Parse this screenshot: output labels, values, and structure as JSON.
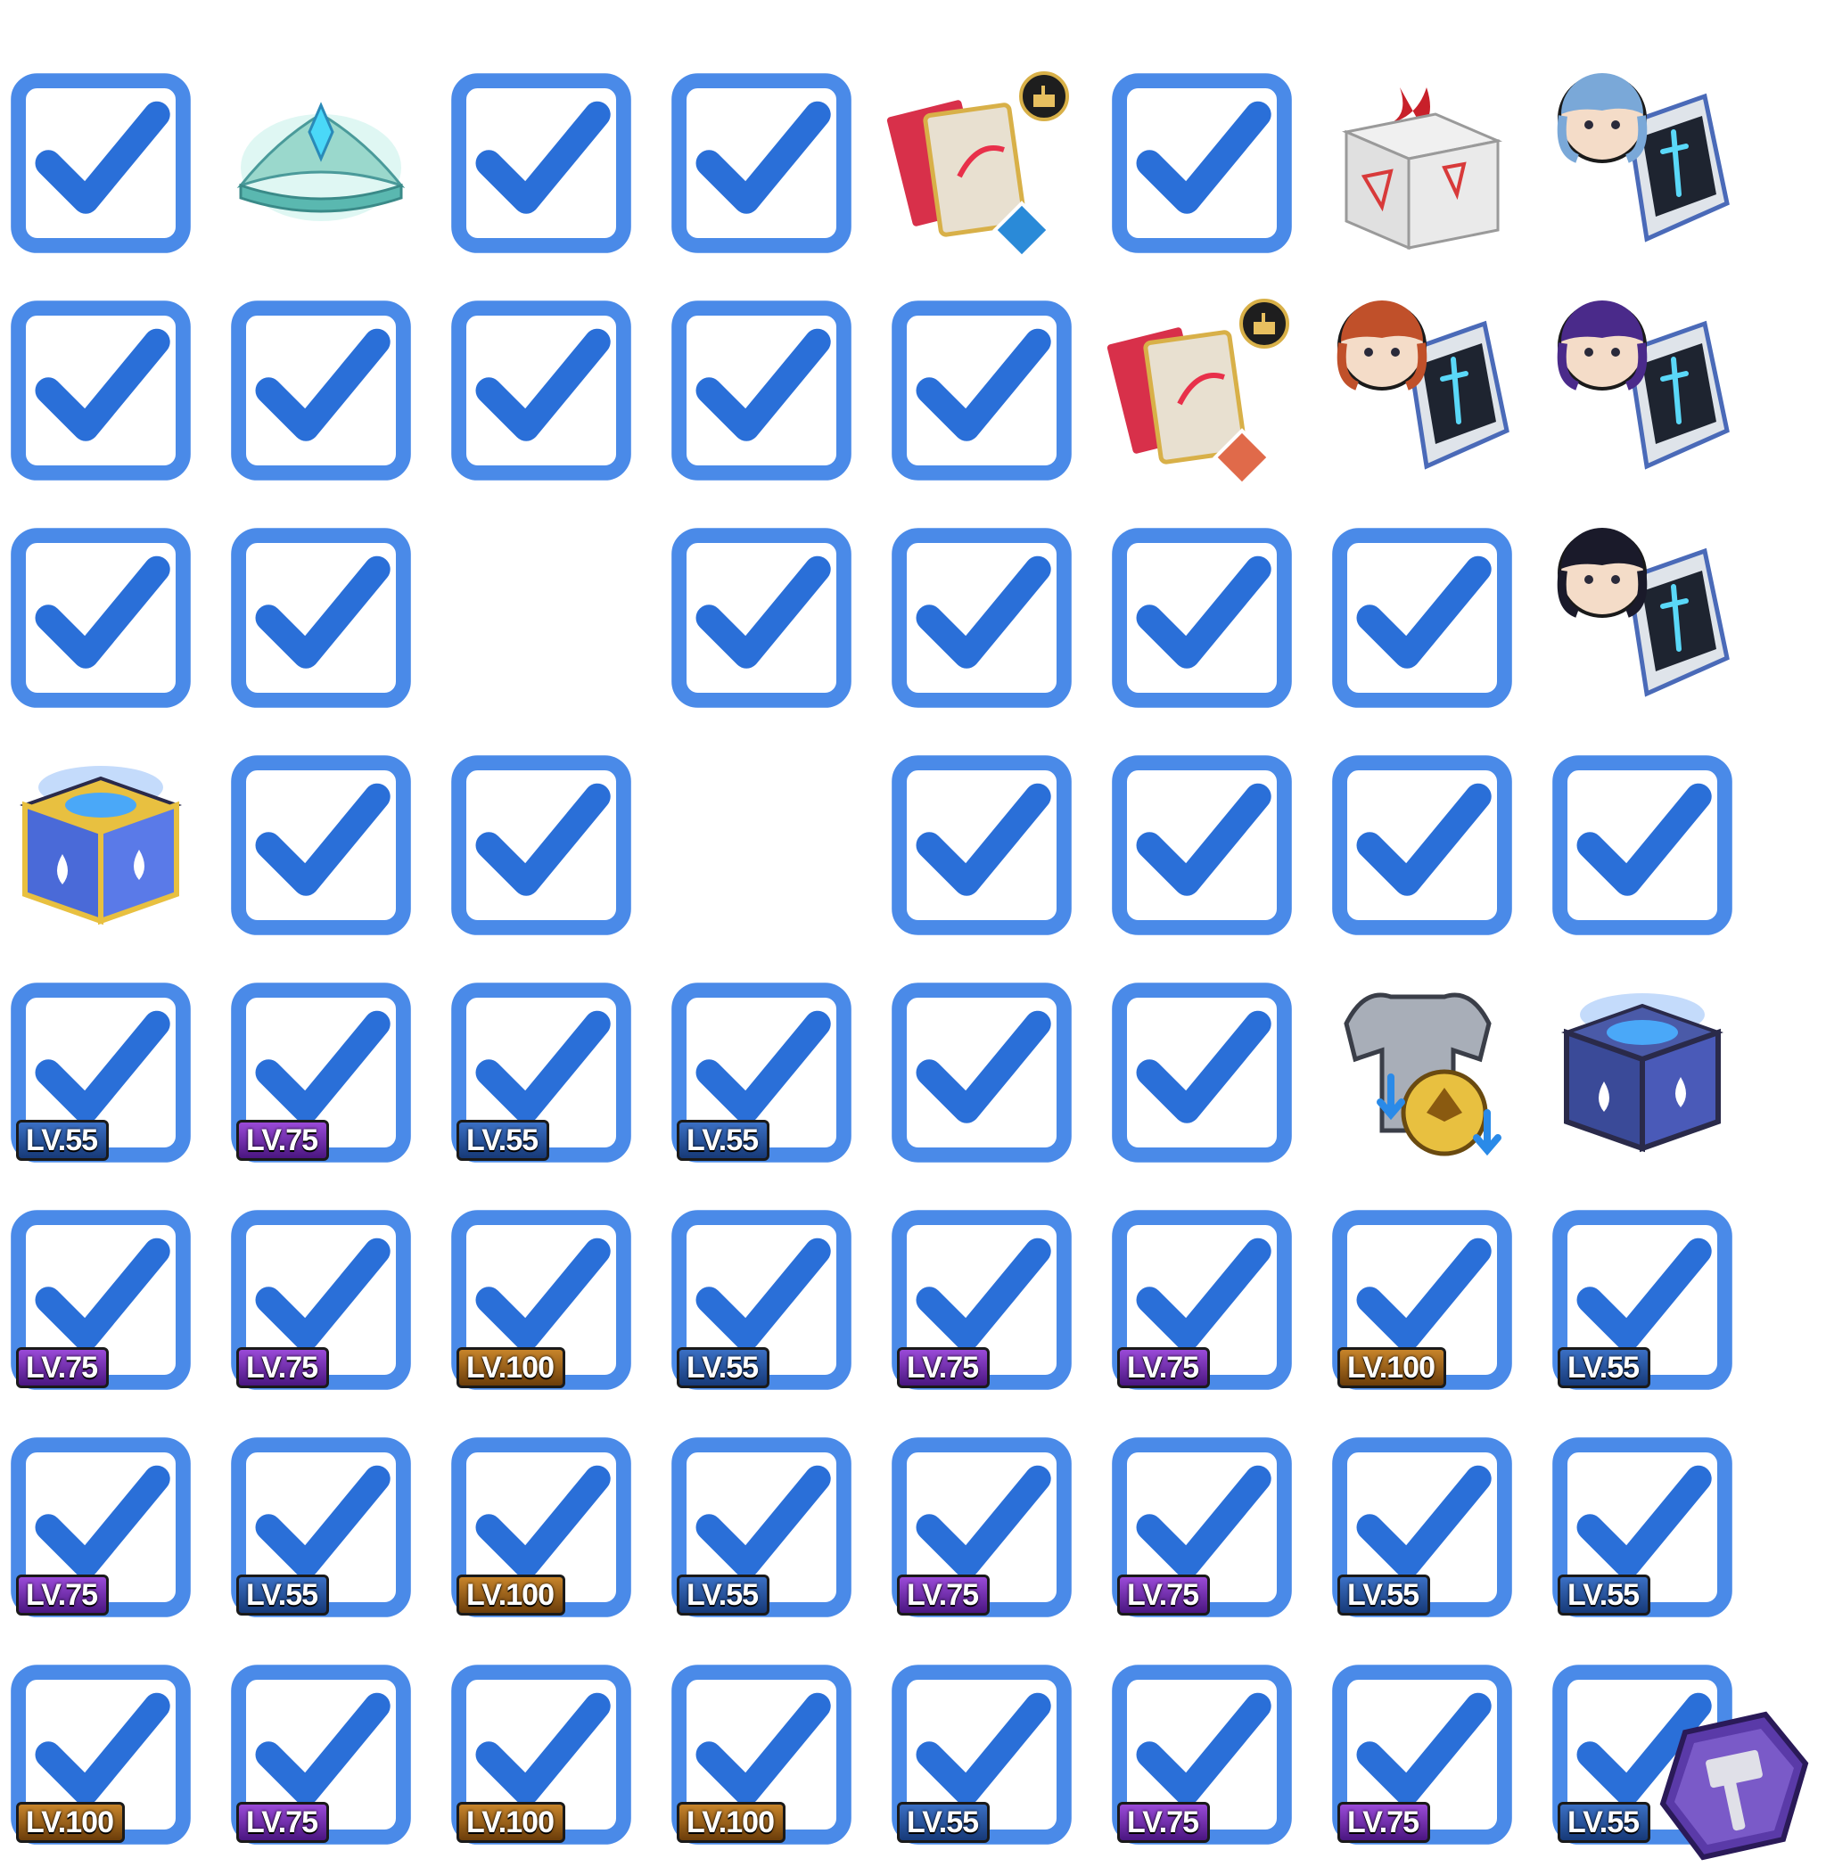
{
  "sheet": {
    "items": [
      {
        "type": "crate",
        "checked": true,
        "badge": "slash-triple-icon"
      },
      {
        "type": "tiara",
        "checked": false
      },
      {
        "type": "crate",
        "checked": true,
        "badge": "claw-icon"
      },
      {
        "type": "crate",
        "checked": true,
        "badge": "swirl-icon"
      },
      {
        "type": "cards",
        "checked": false,
        "accent": "#2a8ad8"
      },
      {
        "type": "pack",
        "checked": true
      },
      {
        "type": "warning-box",
        "checked": false
      },
      {
        "type": "device",
        "checked": false,
        "hair": "#7aa8d8"
      },
      {
        "type": "crate",
        "checked": true,
        "badge": "burst-icon"
      },
      {
        "type": "crate",
        "checked": true,
        "badge": "cross-slash-icon"
      },
      {
        "type": "crate",
        "checked": true,
        "badge": "question-icon"
      },
      {
        "type": "crate",
        "checked": true,
        "badge": "crescent-icon"
      },
      {
        "type": "crate",
        "checked": true,
        "badge": "wing-icon"
      },
      {
        "type": "cards",
        "checked": false,
        "accent": "#e06a4a"
      },
      {
        "type": "device",
        "checked": false,
        "hair": "#c0502a"
      },
      {
        "type": "device",
        "checked": false,
        "hair": "#4a2a8a"
      },
      {
        "type": "crate",
        "checked": true,
        "badge": "vortex-icon"
      },
      {
        "type": "crate",
        "checked": true,
        "badge": "triple-claw-icon"
      },
      {
        "type": "empty"
      },
      {
        "type": "crate",
        "checked": true,
        "badge": "feather-icon"
      },
      {
        "type": "crate",
        "checked": true,
        "badge": "fist-icon"
      },
      {
        "type": "crate",
        "checked": true,
        "badge": "spark-icon"
      },
      {
        "type": "rps",
        "checked": true
      },
      {
        "type": "device",
        "checked": false,
        "hair": "#1a1a2a"
      },
      {
        "type": "cube-gold",
        "checked": false
      },
      {
        "type": "crate",
        "checked": true,
        "badge": "shield-icon"
      },
      {
        "type": "crate",
        "checked": true,
        "badge": "none"
      },
      {
        "type": "empty"
      },
      {
        "type": "crate",
        "checked": true,
        "badge": "comet-icon"
      },
      {
        "type": "crate",
        "checked": true,
        "badge": "none"
      },
      {
        "type": "crate",
        "checked": true,
        "badge": "sun-icon"
      },
      {
        "type": "crate",
        "checked": true,
        "badge": "impact-icon"
      },
      {
        "type": "chest",
        "checked": true,
        "level": "LV.55",
        "tier": "l55",
        "loot": "#8a4ac8"
      },
      {
        "type": "chest",
        "checked": true,
        "level": "LV.75",
        "tier": "l75",
        "loot": "#c84ad8"
      },
      {
        "type": "chest",
        "checked": true,
        "level": "LV.55",
        "tier": "l55",
        "loot": "#4a5aa8"
      },
      {
        "type": "chest",
        "checked": true,
        "level": "LV.55",
        "tier": "l55",
        "loot": "#2ac8c8"
      },
      {
        "type": "blue-box",
        "checked": true
      },
      {
        "type": "blue-box",
        "checked": true
      },
      {
        "type": "armor",
        "checked": false
      },
      {
        "type": "cube-blue",
        "checked": false
      },
      {
        "type": "chest",
        "checked": true,
        "level": "LV.75",
        "tier": "l75",
        "loot": "#3ac83a"
      },
      {
        "type": "chest",
        "checked": true,
        "level": "LV.75",
        "tier": "l75",
        "loot": "#8a4a2a"
      },
      {
        "type": "chest",
        "checked": true,
        "level": "LV.100",
        "tier": "l100",
        "loot": "#8a4a2a"
      },
      {
        "type": "chest",
        "checked": true,
        "level": "LV.55",
        "tier": "l55",
        "loot": "#6a5a3a"
      },
      {
        "type": "chest",
        "checked": true,
        "level": "LV.75",
        "tier": "l75",
        "loot": "#2aa8a8"
      },
      {
        "type": "chest",
        "checked": true,
        "level": "LV.75",
        "tier": "l75",
        "loot": "#d82a2a"
      },
      {
        "type": "chest",
        "checked": true,
        "level": "LV.100",
        "tier": "l100",
        "loot": "#a8987a"
      },
      {
        "type": "chest",
        "checked": true,
        "level": "LV.55",
        "tier": "l55",
        "loot": "#d83a2a"
      },
      {
        "type": "chest",
        "checked": true,
        "level": "LV.75",
        "tier": "l75",
        "loot": "#4a5ab8"
      },
      {
        "type": "chest",
        "checked": true,
        "level": "LV.55",
        "tier": "l55",
        "loot": "#8ac83a"
      },
      {
        "type": "chest",
        "checked": true,
        "level": "LV.100",
        "tier": "l100",
        "loot": "#b8b8d8"
      },
      {
        "type": "chest",
        "checked": true,
        "level": "LV.55",
        "tier": "l55",
        "loot": "#3ad83a"
      },
      {
        "type": "chest",
        "checked": true,
        "level": "LV.75",
        "tier": "l75",
        "loot": "#e82a2a"
      },
      {
        "type": "chest",
        "checked": true,
        "level": "LV.75",
        "tier": "l75",
        "loot": "#3a4a8a"
      },
      {
        "type": "chest",
        "checked": true,
        "level": "LV.55",
        "tier": "l55",
        "loot": "#3a5a9a"
      },
      {
        "type": "chest",
        "checked": true,
        "level": "LV.55",
        "tier": "l55",
        "loot": "#8ab8e8"
      },
      {
        "type": "chest",
        "checked": true,
        "level": "LV.100",
        "tier": "l100",
        "loot": "#6a3aa8"
      },
      {
        "type": "chest",
        "checked": true,
        "level": "LV.75",
        "tier": "l75",
        "loot": "#3a9ae8"
      },
      {
        "type": "chest",
        "checked": true,
        "level": "LV.100",
        "tier": "l100",
        "loot": "#8ab83a"
      },
      {
        "type": "chest",
        "checked": true,
        "level": "LV.100",
        "tier": "l100",
        "loot": "#8a4ac8"
      },
      {
        "type": "chest",
        "checked": true,
        "level": "LV.55",
        "tier": "l55",
        "loot": "#e82a2a"
      },
      {
        "type": "chest",
        "checked": true,
        "level": "LV.75",
        "tier": "l75",
        "loot": "#6a5a3a"
      },
      {
        "type": "chest",
        "checked": true,
        "level": "LV.75",
        "tier": "l75",
        "loot": "#6a8ac8"
      },
      {
        "type": "chest",
        "checked": true,
        "level": "LV.55",
        "tier": "l55",
        "loot": "#4aa8e8"
      },
      {
        "type": "hammer-token",
        "checked": false
      }
    ]
  }
}
